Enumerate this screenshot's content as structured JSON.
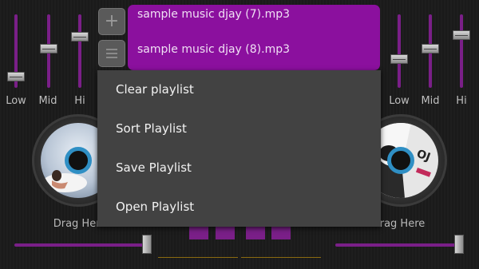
{
  "playlist": {
    "tracks": [
      "sample music djay (7).mp3",
      "sample music djay (8).mp3"
    ],
    "add_icon": "plus-icon",
    "menu_icon": "hamburger-icon"
  },
  "context_menu": {
    "items": [
      "Clear playlist",
      "Sort Playlist",
      "Save Playlist",
      "Open Playlist"
    ]
  },
  "left_deck": {
    "eq_labels": [
      "Low",
      "Mid",
      "Hi"
    ],
    "drag_label": "Drag Here"
  },
  "right_deck": {
    "eq_labels": [
      "Low",
      "Mid",
      "Hi"
    ],
    "drag_label": "Drag Here"
  },
  "colors": {
    "accent": "#8b109e",
    "track": "#7a1f88",
    "menu_bg": "#424242",
    "hub": "#2f8fc4"
  }
}
